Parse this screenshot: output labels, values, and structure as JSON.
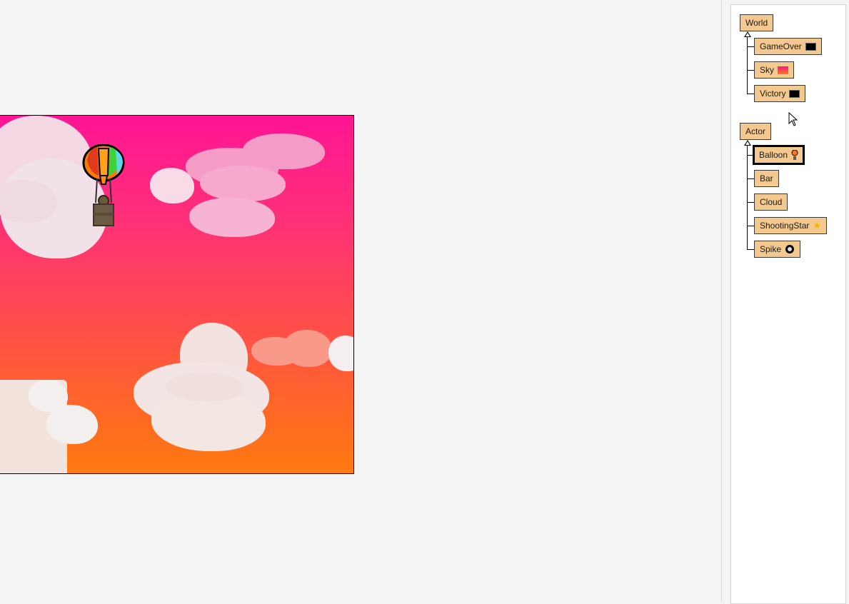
{
  "world": {
    "sky_colors": [
      "#ff1493",
      "#ff4a50",
      "#ff7a10"
    ],
    "actor_image": "hot-air-balloon"
  },
  "class_panel": {
    "world_root": "World",
    "world_subclasses": [
      {
        "label": "GameOver",
        "icon": "black-screen-thumbnail"
      },
      {
        "label": "Sky",
        "icon": "pink-gradient-thumbnail"
      },
      {
        "label": "Victory",
        "icon": "black-screen-thumbnail"
      }
    ],
    "actor_root": "Actor",
    "actor_subclasses": [
      {
        "label": "Balloon",
        "icon": "balloon-thumbnail",
        "selected": true
      },
      {
        "label": "Bar",
        "icon": "none"
      },
      {
        "label": "Cloud",
        "icon": "none"
      },
      {
        "label": "ShootingStar",
        "icon": "star-thumbnail"
      },
      {
        "label": "Spike",
        "icon": "spike-ball-thumbnail"
      }
    ]
  },
  "colors": {
    "class_box": "#f3c98f",
    "panel_bg": "#ffffff",
    "app_bg": "#f3f4f3"
  }
}
